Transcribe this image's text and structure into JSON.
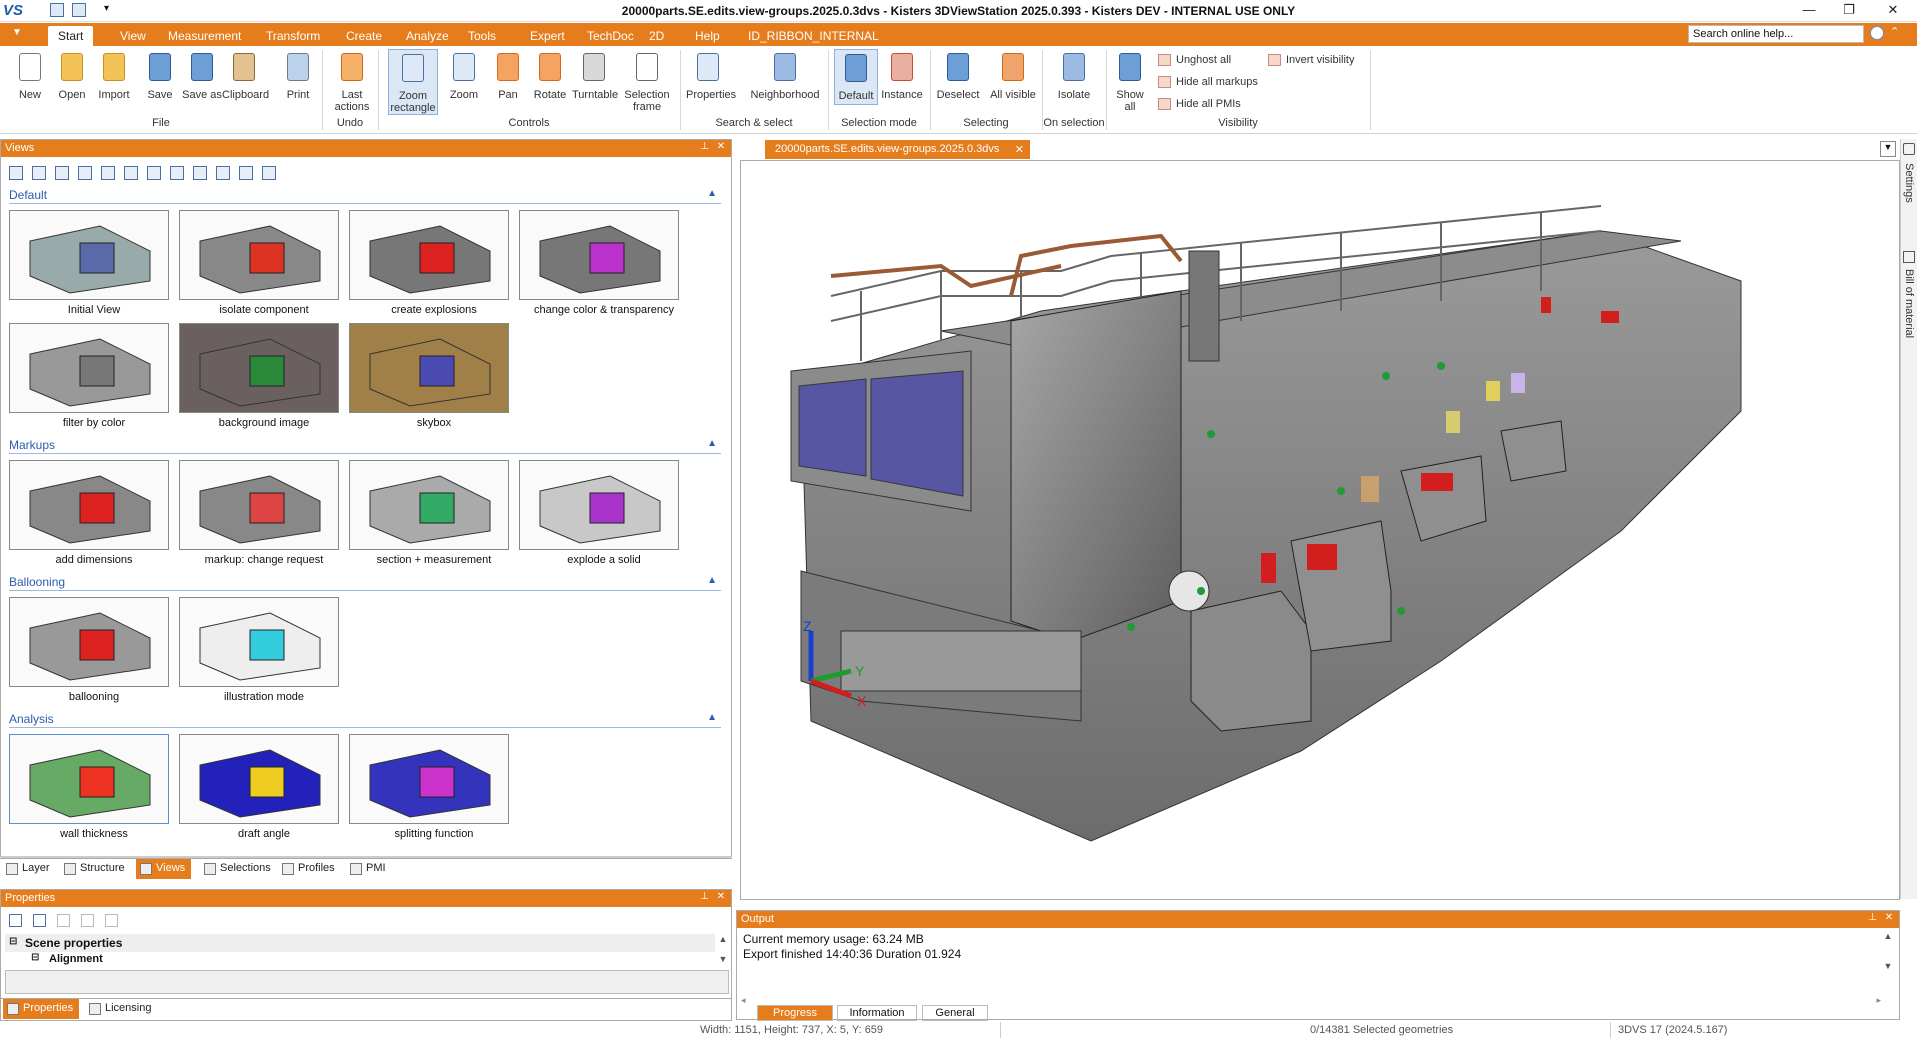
{
  "window": {
    "title": "20000parts.SE.edits.view-groups.2025.0.3dvs - Kisters 3DViewStation 2025.0.393 - Kisters DEV - INTERNAL USE ONLY",
    "logo": "VS",
    "minimize_icon": "minimize-icon",
    "maximize_icon": "restore-icon",
    "close_icon": "close-icon"
  },
  "ribbon": {
    "app_menu": "▼",
    "tabs": [
      "Start",
      "View",
      "Measurement",
      "Transform",
      "Create",
      "Analyze",
      "Tools",
      "Expert",
      "TechDoc",
      "2D",
      "Help",
      "ID_RIBBON_INTERNAL"
    ],
    "active_tab": "Start",
    "search_placeholder": "Search online help...",
    "groups": {
      "file": {
        "label": "File",
        "buttons": [
          "New",
          "Open",
          "Import",
          "Save",
          "Save as",
          "Clipboard",
          "Print"
        ]
      },
      "undo": {
        "label": "Undo",
        "buttons": [
          "Last actions"
        ]
      },
      "controls": {
        "label": "Controls",
        "buttons": [
          "Zoom rectangle",
          "Zoom",
          "Pan",
          "Rotate",
          "Turntable",
          "Selection frame"
        ]
      },
      "search": {
        "label": "Search & select",
        "buttons": [
          "Properties",
          "Neighborhood"
        ]
      },
      "selmode": {
        "label": "Selection mode",
        "buttons": [
          "Default",
          "Instance"
        ]
      },
      "selecting": {
        "label": "Selecting",
        "buttons": [
          "Deselect",
          "All visible"
        ]
      },
      "onsel": {
        "label": "On selection",
        "buttons": [
          "Isolate"
        ]
      },
      "visibility": {
        "label": "Visibility",
        "buttons": [
          "Show all"
        ],
        "small": [
          "Unghost all",
          "Hide all markups",
          "Hide all PMIs",
          "Invert visibility"
        ]
      }
    }
  },
  "views_panel": {
    "title": "Views",
    "sections": [
      {
        "name": "Default",
        "items": [
          "Initial View",
          "isolate component",
          "create explosions",
          "change color & transparency",
          "filter by color",
          "background image",
          "skybox"
        ]
      },
      {
        "name": "Markups",
        "items": [
          "add dimensions",
          "markup: change request",
          "section + measurement",
          "explode a solid"
        ]
      },
      {
        "name": "Ballooning",
        "items": [
          "ballooning",
          "illustration mode"
        ]
      },
      {
        "name": "Analysis",
        "items": [
          "wall thickness",
          "draft angle",
          "splitting function"
        ]
      }
    ],
    "bottom_tabs": [
      "Layer",
      "Structure",
      "Views",
      "Selections",
      "Profiles",
      "PMI"
    ],
    "active_bottom_tab": "Views"
  },
  "properties_panel": {
    "title": "Properties",
    "tree": [
      "Scene properties",
      "Alignment"
    ],
    "bottom_tabs": [
      "Properties",
      "Licensing"
    ],
    "active_bottom_tab": "Properties"
  },
  "document": {
    "tab_label": "20000parts.SE.edits.view-groups.2025.0.3dvs",
    "side_tabs": [
      "Settings",
      "Bill of material"
    ],
    "axes": [
      "Z",
      "Y",
      "X"
    ]
  },
  "output_panel": {
    "title": "Output",
    "lines": [
      "Current memory usage: 63.24 MB",
      "Export finished 14:40:36 Duration 01.924"
    ],
    "tabs": [
      "Progress",
      "Information",
      "General"
    ],
    "active_tab": "Progress"
  },
  "status": {
    "dimensions": "Width: 1151, Height: 737, X: 5, Y: 659",
    "selection": "0/14381 Selected geometries",
    "version": "3DVS 17 (2024.5.167)"
  },
  "colors": {
    "accent": "#e57d1d",
    "link": "#2a5db0"
  }
}
